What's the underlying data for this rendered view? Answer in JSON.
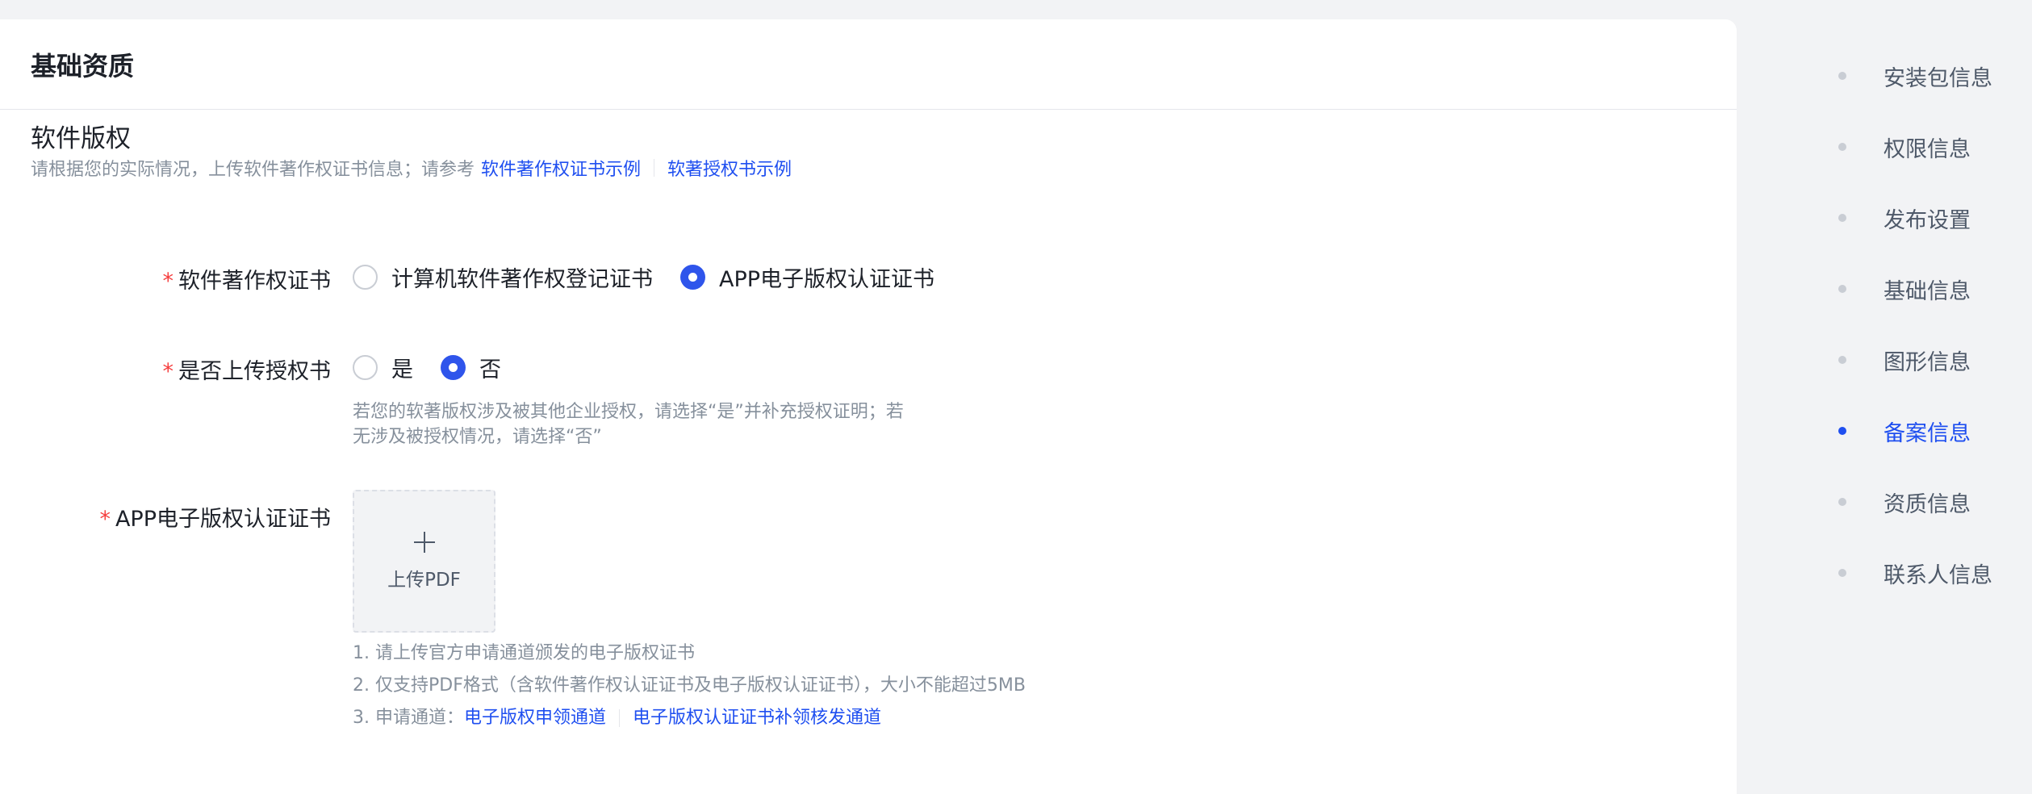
{
  "card": {
    "title": "基础资质"
  },
  "software_copyright": {
    "title": "软件版权",
    "desc_prefix": "请根据您的实际情况，上传软件著作权证书信息；请参考",
    "link_cert_example": "软件著作权证书示例",
    "link_auth_example": "软著授权书示例"
  },
  "cert_type": {
    "required_mark": "*",
    "label": "软件著作权证书",
    "options": [
      {
        "label": "计算机软件著作权登记证书",
        "checked": false
      },
      {
        "label": "APP电子版权认证证书",
        "checked": true
      }
    ]
  },
  "upload_auth": {
    "required_mark": "*",
    "label": "是否上传授权书",
    "options": [
      {
        "label": "是",
        "checked": false
      },
      {
        "label": "否",
        "checked": true
      }
    ],
    "hint_line1": "若您的软著版权涉及被其他企业授权，请选择“是”并补充授权证明；若",
    "hint_line2": "无涉及被授权情况，请选择“否”"
  },
  "app_cert": {
    "required_mark": "*",
    "label": "APP电子版权认证证书",
    "upload_label": "上传PDF",
    "note1": "1. 请上传官方申请通道颁发的电子版权证书",
    "note2": "2. 仅支持PDF格式（含软件著作权认证证书及电子版权认证证书），大小不能超过5MB",
    "note3_prefix": "3. 申请通道：",
    "note3_link1": "电子版权申领通道",
    "note3_link2": "电子版权认证证书补领核发通道"
  },
  "anchor_nav": {
    "items": [
      {
        "label": "安装包信息",
        "active": false
      },
      {
        "label": "权限信息",
        "active": false
      },
      {
        "label": "发布设置",
        "active": false
      },
      {
        "label": "基础信息",
        "active": false
      },
      {
        "label": "图形信息",
        "active": false
      },
      {
        "label": "备案信息",
        "active": true
      },
      {
        "label": "资质信息",
        "active": false
      },
      {
        "label": "联系人信息",
        "active": false
      }
    ]
  },
  "colors": {
    "accent": "#1f4ff0",
    "radio_checked": "#2f55eb",
    "required": "#f53f3f",
    "muted_text": "#86909c"
  }
}
